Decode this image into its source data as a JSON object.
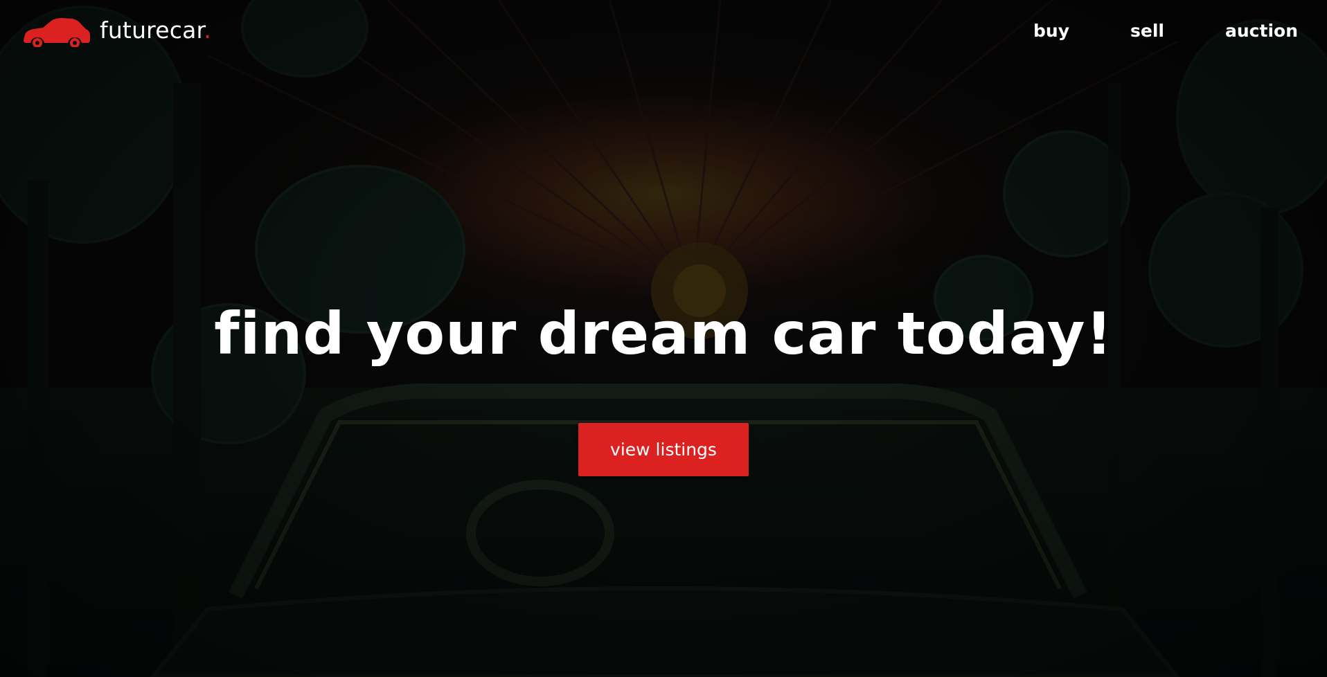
{
  "brand": {
    "name": "futurecar",
    "dot": ".",
    "accent_color": "#dc2121",
    "icon": "car-icon"
  },
  "nav": {
    "items": [
      {
        "label": "buy"
      },
      {
        "label": "sell"
      },
      {
        "label": "auction"
      }
    ]
  },
  "hero": {
    "title": "find your dream car today!",
    "cta_label": "view listings",
    "background": "illustration-forest-road-convertible"
  }
}
